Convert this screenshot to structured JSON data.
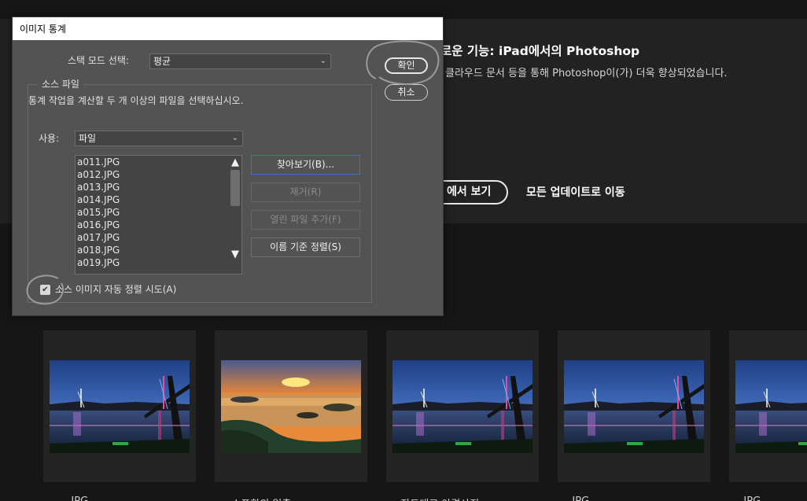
{
  "background": {
    "hero_title": "로운 기능: iPad에서의 Photoshop",
    "hero_description": "클라우드 문서 등을 통해 Photoshop이(가) 더욱 향상되었습니다.",
    "hero_button": "에서 보기",
    "hero_link": "모든 업데이트로 이동",
    "recent_files": [
      {
        "caption": "...JPG",
        "thumbnail": "bridge-night-photo"
      },
      {
        "caption": "...스포항의 일출",
        "thumbnail": "sunrise-island-photo"
      },
      {
        "caption": "...장도대교 야경사진",
        "thumbnail": "bridge-night-photo"
      },
      {
        "caption": "...JPG",
        "thumbnail": "bridge-night-photo"
      },
      {
        "caption": "...JPG",
        "thumbnail": "bridge-night-photo"
      }
    ]
  },
  "dialog": {
    "title": "이미지 통계",
    "stack_mode_label": "스택 모드 선택:",
    "stack_mode_value": "평균",
    "ok_button": "확인",
    "cancel_button": "취소",
    "source_group_label": "소스 파일",
    "instruction": "통계 작업을 계산할 두 개 이상의 파일을 선택하십시오.",
    "use_label": "사용:",
    "use_value": "파일",
    "files": [
      "a011.JPG",
      "a012.JPG",
      "a013.JPG",
      "a014.JPG",
      "a015.JPG",
      "a016.JPG",
      "a017.JPG",
      "a018.JPG",
      "a019.JPG"
    ],
    "browse_button": "찾아보기(B)...",
    "remove_button": "제거(R)",
    "add_open_files_button": "열린 파일 추가(F)",
    "sort_by_name_button": "이름 기준 정렬(S)",
    "auto_align_label": "소스 이미지 자동 정렬 시도(A)",
    "auto_align_checked": true
  },
  "colors": {
    "dialog_bg": "#535353",
    "focus_border": "#3c73c6",
    "annotation_circle": "#9a9a9a"
  }
}
